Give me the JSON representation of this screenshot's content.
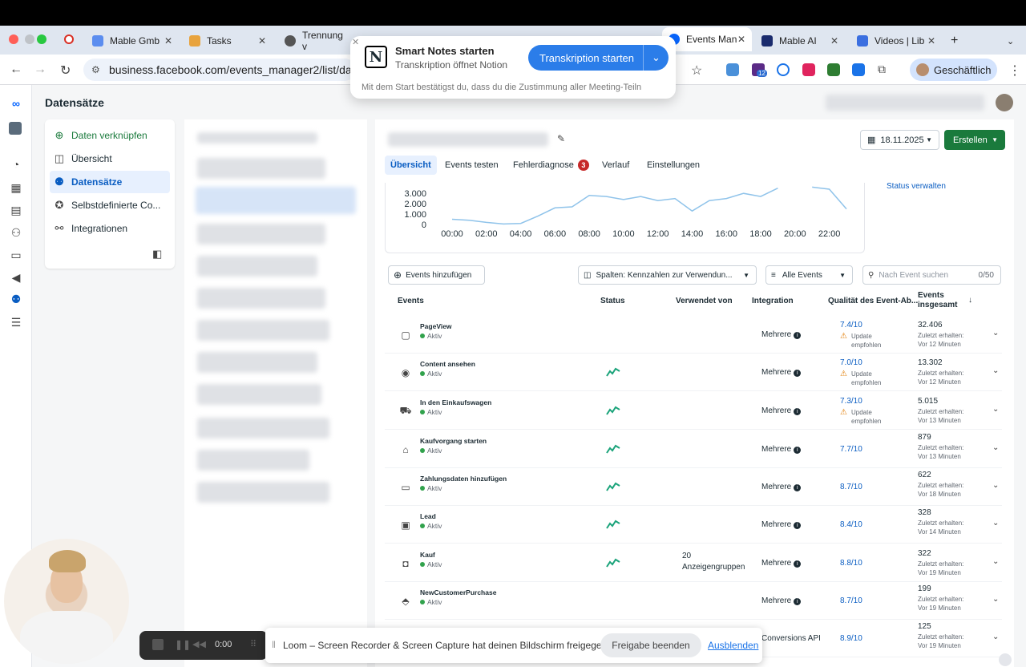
{
  "browser": {
    "tabs": [
      {
        "label": "Mable Gmb",
        "color": "#5b8def"
      },
      {
        "label": "Tasks",
        "color": "#e8a33d"
      },
      {
        "label": "Trennung v",
        "color": "#555555"
      },
      {
        "label": "Events Man",
        "color": "#0866ff"
      },
      {
        "label": "Mable AI",
        "color": "#1a2b6d"
      },
      {
        "label": "Videos | Lib",
        "color": "#3b6fe0"
      }
    ],
    "url": "business.facebook.com/events_manager2/list/datas",
    "profile_label": "Geschäftlich",
    "ext_badge": "12"
  },
  "notion_popup": {
    "logo": "N",
    "title": "Smart Notes starten",
    "subtitle": "Transkription öffnet Notion",
    "button": "Transkription starten",
    "consent": "Mit dem Start bestätigst du, dass du die Zustimmung aller Meeting-Teiln"
  },
  "page": {
    "title": "Datensätze"
  },
  "sidenav": {
    "items": [
      {
        "label": "Daten verknüpfen",
        "icon": "plus-circle-icon"
      },
      {
        "label": "Übersicht",
        "icon": "layout-icon"
      },
      {
        "label": "Datensätze",
        "icon": "dataset-icon"
      },
      {
        "label": "Selbstdefinierte Co...",
        "icon": "custom-conversion-icon"
      },
      {
        "label": "Integrationen",
        "icon": "integrations-icon"
      }
    ]
  },
  "main": {
    "date": "18.11.2025",
    "create_label": "Erstellen",
    "tabs": [
      "Übersicht",
      "Events testen",
      "Fehlerdiagnose",
      "Verlauf",
      "Einstellungen"
    ],
    "error_count": "3",
    "status_link": "Status verwalten",
    "toolbar": {
      "add_events": "Events hinzufügen",
      "columns": "Spalten: Kennzahlen zur Verwendun...",
      "filter": "Alle Events",
      "search_placeholder": "Nach Event suchen",
      "search_count": "0/50"
    },
    "headers": {
      "events": "Events",
      "status": "Status",
      "used_by": "Verwendet von",
      "integration": "Integration",
      "quality": "Qualität des Event-Ab...",
      "total_line1": "Events",
      "total_line2": "insgesamt"
    },
    "rows": [
      {
        "name": "PageView",
        "status": "Aktiv",
        "icon": "page-icon",
        "spark": false,
        "used": "",
        "integration": "Mehrere",
        "quality": "7.4/10",
        "warn": "Update empfohlen",
        "total": "32.406",
        "last1": "Zuletzt erhalten:",
        "last2": "Vor 12 Minuten"
      },
      {
        "name": "Content ansehen",
        "status": "Aktiv",
        "icon": "eye-icon",
        "spark": true,
        "used": "",
        "integration": "Mehrere",
        "quality": "7.0/10",
        "warn": "Update empfohlen",
        "total": "13.302",
        "last1": "Zuletzt erhalten:",
        "last2": "Vor 12 Minuten"
      },
      {
        "name": "In den Einkaufswagen",
        "status": "Aktiv",
        "icon": "cart-icon",
        "spark": true,
        "used": "",
        "integration": "Mehrere",
        "quality": "7.3/10",
        "warn": "Update empfohlen",
        "total": "5.015",
        "last1": "Zuletzt erhalten:",
        "last2": "Vor 13 Minuten"
      },
      {
        "name": "Kaufvorgang starten",
        "status": "Aktiv",
        "icon": "basket-icon",
        "spark": true,
        "used": "",
        "integration": "Mehrere",
        "quality": "7.7/10",
        "warn": "",
        "total": "879",
        "last1": "Zuletzt erhalten:",
        "last2": "Vor 13 Minuten"
      },
      {
        "name": "Zahlungsdaten hinzufügen",
        "status": "Aktiv",
        "icon": "card-icon",
        "spark": true,
        "used": "",
        "integration": "Mehrere",
        "quality": "8.7/10",
        "warn": "",
        "total": "622",
        "last1": "Zuletzt erhalten:",
        "last2": "Vor 18 Minuten"
      },
      {
        "name": "Lead",
        "status": "Aktiv",
        "icon": "contact-card-icon",
        "spark": true,
        "used": "",
        "integration": "Mehrere",
        "quality": "8.4/10",
        "warn": "",
        "total": "328",
        "last1": "Zuletzt erhalten:",
        "last2": "Vor 14 Minuten"
      },
      {
        "name": "Kauf",
        "status": "Aktiv",
        "icon": "bag-icon",
        "spark": true,
        "used": "20 Anzeigengruppen",
        "integration": "Mehrere",
        "quality": "8.8/10",
        "warn": "",
        "total": "322",
        "last1": "Zuletzt erhalten:",
        "last2": "Vor 19 Minuten"
      },
      {
        "name": "NewCustomerPurchase",
        "status": "Aktiv",
        "icon": "tag-icon",
        "spark": false,
        "used": "",
        "integration": "Mehrere",
        "quality": "8.7/10",
        "warn": "",
        "total": "199",
        "last1": "Zuletzt erhalten:",
        "last2": "Vor 19 Minuten"
      },
      {
        "name": "",
        "status": "",
        "icon": "",
        "spark": false,
        "used": "",
        "integration": "Conversions API",
        "quality": "8.9/10",
        "warn": "",
        "total": "125",
        "last1": "Zuletzt erhalten:",
        "last2": "Vor 19 Minuten"
      }
    ]
  },
  "chart_data": {
    "type": "line",
    "x": [
      "00:00",
      "01:00",
      "02:00",
      "03:00",
      "04:00",
      "05:00",
      "06:00",
      "07:00",
      "08:00",
      "09:00",
      "10:00",
      "11:00",
      "12:00",
      "13:00",
      "14:00",
      "15:00",
      "16:00",
      "17:00",
      "18:00",
      "19:00",
      "20:00",
      "21:00",
      "22:00",
      "23:00"
    ],
    "series": [
      {
        "values": [
          500,
          400,
          200,
          50,
          100,
          800,
          1600,
          1700,
          2800,
          2700,
          2400,
          2700,
          2300,
          2500,
          1300,
          2300,
          2500,
          3000,
          2700,
          3500,
          null,
          3600,
          3400,
          1500
        ]
      }
    ],
    "xticks": [
      "00:00",
      "02:00",
      "04:00",
      "06:00",
      "08:00",
      "10:00",
      "12:00",
      "14:00",
      "16:00",
      "18:00",
      "20:00",
      "22:00"
    ],
    "yticks": [
      "3.000",
      "2.000",
      "1.000",
      "0"
    ],
    "ylim": [
      0,
      3400
    ]
  },
  "loom": {
    "time": "0:00",
    "message": "Loom – Screen Recorder & Screen Capture hat deinen Bildschirm freigegeben.",
    "stop": "Freigabe beenden",
    "hide": "Ausblenden"
  },
  "colors": {
    "accent": "#0a5dc2",
    "create": "#1a7a3c",
    "active_dot": "#31a24c",
    "warn": "#e07a00"
  }
}
